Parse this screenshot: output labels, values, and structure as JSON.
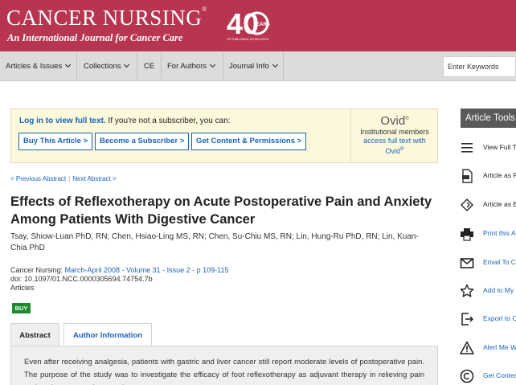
{
  "header": {
    "journal_title": "CANCER NURSING",
    "tm": "®",
    "tagline": "An International Journal for Cancer Care",
    "anniversary_number": "40",
    "anniversary_years": "YEARS",
    "anniversary_caption": "OF PUBLISHING EXCELLENCE",
    "brand_color": "#b8354f"
  },
  "nav": {
    "items": [
      {
        "label": "Articles & Issues",
        "has_dropdown": true
      },
      {
        "label": "Collections",
        "has_dropdown": true
      },
      {
        "label": "CE",
        "has_dropdown": false
      },
      {
        "label": "For Authors",
        "has_dropdown": true
      },
      {
        "label": "Journal Info",
        "has_dropdown": true
      }
    ],
    "search_placeholder": "Enter Keywords"
  },
  "access": {
    "login_link": "Log in to view full text.",
    "subscriber_text": " If you're not a subscriber, you can:",
    "buttons": [
      "Buy This Article",
      "Become a Subscriber",
      "Get Content & Permissions"
    ],
    "ovid_logo": "Ovid",
    "ovid_reg": "®",
    "ovid_line": "Institutional members",
    "ovid_link1": "access full text with",
    "ovid_link2": "Ovid"
  },
  "article": {
    "prev": "< Previous Abstract",
    "sep": "|",
    "next": "Next Abstract >",
    "title": "Effects of Reflexotherapy on Acute Postoperative Pain and Anxiety Among Patients With Digestive Cancer",
    "authors": "Tsay, Shiow-Luan PhD, RN; Chen, Hsiao-Ling MS, RN; Chen, Su-Chiu MS, RN; Lin, Hung-Ru PhD, RN; Lin, Kuan-Chia PhD",
    "journal_prefix": "Cancer Nursing: ",
    "issue_info": "March-April 2008 - Volume 31 - Issue 2 - p 109-115",
    "doi": "doi: 10.1097/01.NCC.0000305694.74754.7b",
    "section": "Articles",
    "buy_badge": "BUY",
    "tabs": [
      "Abstract",
      "Author Information"
    ],
    "abstract_text": "Even after receiving analgesia, patients with gastric and liver cancer still report moderate levels of postoperative pain. The purpose of the study was to investigate the efficacy of foot reflexotherapy as adjuvant therapy in relieving pain and anxiety among these patients."
  },
  "tools": {
    "heading": "Article Tools",
    "items": [
      {
        "label": "View Full Text",
        "icon": "list-icon"
      },
      {
        "label": "Article as PDF",
        "icon": "pdf-icon"
      },
      {
        "label": "Article as EPUB",
        "icon": "epub-icon"
      },
      {
        "label": "Print this Article",
        "icon": "printer-icon"
      },
      {
        "label": "Email To Colleague",
        "icon": "email-icon"
      },
      {
        "label": "Add to My Favorites",
        "icon": "star-icon"
      },
      {
        "label": "Export to Citation Manager",
        "icon": "export-icon"
      },
      {
        "label": "Alert Me When Cited",
        "icon": "alert-icon"
      },
      {
        "label": "Get Content & Permissions",
        "icon": "copyright-icon"
      }
    ]
  }
}
